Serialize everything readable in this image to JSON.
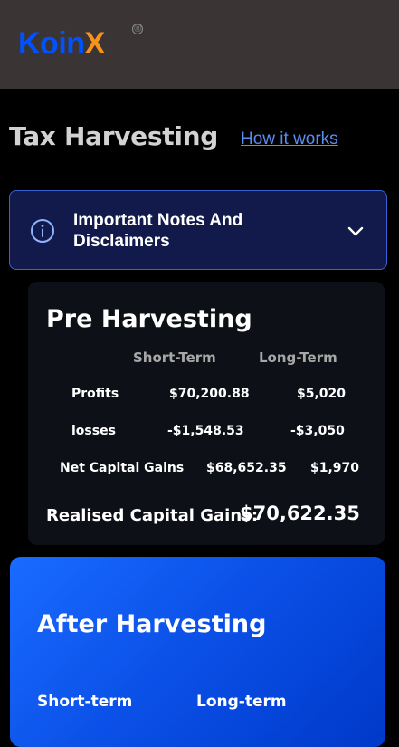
{
  "header": {
    "logo_primary": "Koin",
    "logo_accent": "X",
    "logo_reg": "®"
  },
  "page": {
    "title": "Tax Harvesting",
    "how_link": "How it works"
  },
  "notes": {
    "label": "Important Notes And Disclaimers",
    "icon": "info-icon",
    "toggle_icon": "chevron-down-icon"
  },
  "pre": {
    "title": "Pre Harvesting",
    "columns": [
      "Short-Term",
      "Long-Term"
    ],
    "rows": [
      {
        "label": "Profits",
        "short": "$70,200.88",
        "long": "$5,020"
      },
      {
        "label": "losses",
        "short": "-$1,548.53",
        "long": "-$3,050"
      },
      {
        "label": "Net Capital Gains",
        "short": "$68,652.35",
        "long": "$1,970"
      }
    ],
    "realised_label": "Realised Capital Gains:",
    "realised_value": "$70,622.35"
  },
  "after": {
    "title": "After Harvesting",
    "columns": [
      "Short-term",
      "Long-term"
    ]
  },
  "colors": {
    "brand_blue": "#0052fe",
    "brand_orange": "#f7931a",
    "link": "#5b8def",
    "after_card": "#0a4fe6"
  }
}
